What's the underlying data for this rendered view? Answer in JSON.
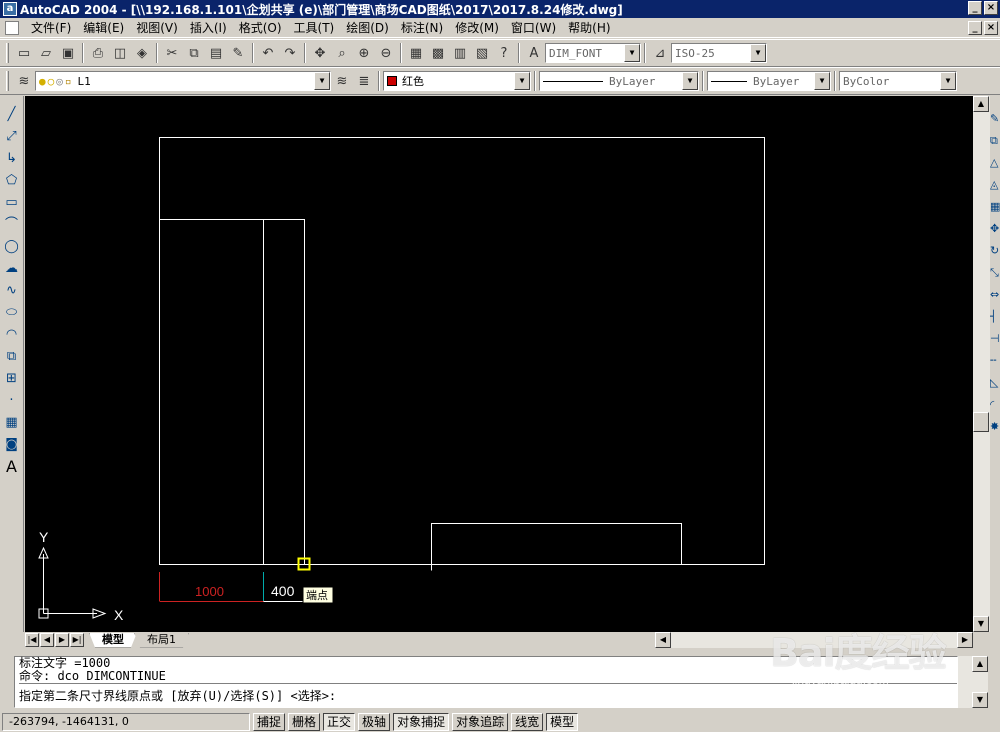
{
  "window": {
    "title": "AutoCAD 2004 - [\\\\192.168.1.101\\企划共享 (e)\\部门管理\\商场CAD图纸\\2017\\2017.8.24修改.dwg]"
  },
  "menu": [
    {
      "label": "文件(F)"
    },
    {
      "label": "编辑(E)"
    },
    {
      "label": "视图(V)"
    },
    {
      "label": "插入(I)"
    },
    {
      "label": "格式(O)"
    },
    {
      "label": "工具(T)"
    },
    {
      "label": "绘图(D)"
    },
    {
      "label": "标注(N)"
    },
    {
      "label": "修改(M)"
    },
    {
      "label": "窗口(W)"
    },
    {
      "label": "帮助(H)"
    }
  ],
  "standard_toolbar": {
    "text_style": "DIM_FONT",
    "dim_style": "ISO-25"
  },
  "properties_toolbar": {
    "layer": "L1",
    "color": "红色",
    "color_hex": "#cc0000",
    "linetype": "ByLayer",
    "lineweight": "ByLayer",
    "plot_style": "ByColor"
  },
  "drawing": {
    "dimension_value_1": "1000",
    "dimension_value_2": "400",
    "osnap_tooltip": "端点",
    "ucs_x_label": "X",
    "ucs_y_label": "Y",
    "dimension_color": "#cc2222",
    "line_color": "#ffffff",
    "dim2_ext_color": "#00aaaa",
    "marker_color": "#ffff00"
  },
  "layout_tabs": [
    {
      "label": "模型",
      "active": true
    },
    {
      "label": "布局1",
      "active": false
    }
  ],
  "command_window": {
    "lines": [
      "标注文字 =1000",
      "命令: dco DIMCONTINUE"
    ],
    "prompt": "指定第二条尺寸界线原点或 [放弃(U)/选择(S)] <选择>:"
  },
  "status_bar": {
    "coordinates": "-263794, -1464131, 0",
    "toggles": [
      {
        "label": "捕捉",
        "on": false
      },
      {
        "label": "栅格",
        "on": false
      },
      {
        "label": "正交",
        "on": true
      },
      {
        "label": "极轴",
        "on": false
      },
      {
        "label": "对象捕捉",
        "on": true
      },
      {
        "label": "对象追踪",
        "on": false
      },
      {
        "label": "线宽",
        "on": false
      },
      {
        "label": "模型",
        "on": true
      }
    ]
  },
  "watermark": {
    "main": "Bai度经验",
    "sub": "jingyan.baidu.com"
  }
}
